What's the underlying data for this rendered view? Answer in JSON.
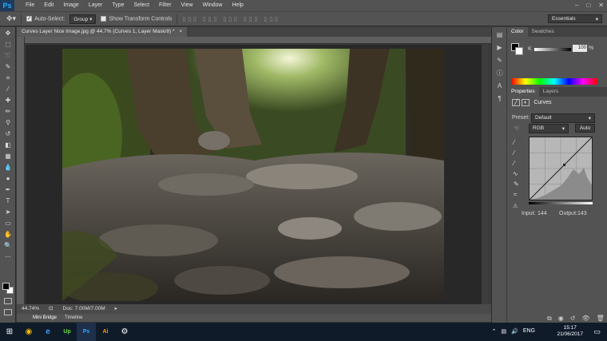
{
  "app": {
    "logo": "Ps",
    "menus": [
      "File",
      "Edit",
      "Image",
      "Layer",
      "Type",
      "Select",
      "Filter",
      "View",
      "Window",
      "Help"
    ],
    "window_controls": [
      "–",
      "□",
      "✕"
    ]
  },
  "options": {
    "auto_select_label": "Auto-Select:",
    "auto_select_value": "Group",
    "transform_label": "Show Transform Controls",
    "workspace": "Essentials"
  },
  "document": {
    "tab_title": "Curves Layer Nice Image.jpg @ 44.7% (Curves 1, Layer Mask/8) *",
    "zoom": "44.74%",
    "doc_info": "Doc: 7.00M/7.00M"
  },
  "bottom_tabs": [
    "Mini Bridge",
    "Timeline"
  ],
  "panels": {
    "color_tabs": [
      "Color",
      "Swatches"
    ],
    "k_label": "K",
    "k_value": "100",
    "k_unit": "%",
    "properties_tabs": [
      "Properties",
      "Layers"
    ],
    "properties_title": "Curves",
    "preset_label": "Preset:",
    "preset_value": "Default",
    "channel_value": "RGB",
    "auto_label": "Auto",
    "input_label": "Input:",
    "input_value": "144",
    "output_label": "Output:",
    "output_value": "143"
  },
  "taskbar": {
    "apps": [
      "start-icon",
      "chrome-icon",
      "edge-icon",
      "upwork-icon",
      "photoshop-icon",
      "illustrator-icon",
      "steam-icon"
    ],
    "app_glyphs": [
      "⊞",
      "◉",
      "e",
      "Up",
      "Ps",
      "Ai",
      "⚙"
    ],
    "language": "ENG",
    "time": "15:17",
    "date": "21/06/2017"
  },
  "colors": {
    "panel_bg": "#535353",
    "photoshop_blue": "#31a8ff",
    "taskbar_bg": "#101b2a"
  }
}
